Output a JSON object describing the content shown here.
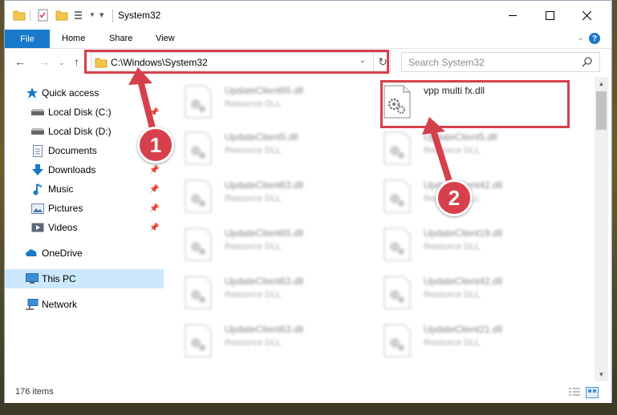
{
  "window": {
    "title": "System32",
    "controls": {
      "minimize": "—",
      "maximize": "☐",
      "close": "✕"
    }
  },
  "ribbon": {
    "file_tab": "File",
    "tabs": [
      "Home",
      "Share",
      "View"
    ],
    "help": "?"
  },
  "address_bar": {
    "path": "C:\\Windows\\System32",
    "search_placeholder": "Search System32"
  },
  "nav_pane": {
    "items": [
      {
        "label": "Quick access",
        "icon": "star-icon",
        "pinned": false
      },
      {
        "label": "Local Disk (C:)",
        "icon": "drive-icon",
        "pinned": true
      },
      {
        "label": "Local Disk (D:)",
        "icon": "drive-icon",
        "pinned": false
      },
      {
        "label": "Documents",
        "icon": "documents-icon",
        "pinned": true
      },
      {
        "label": "Downloads",
        "icon": "downloads-icon",
        "pinned": true
      },
      {
        "label": "Music",
        "icon": "music-icon",
        "pinned": true
      },
      {
        "label": "Pictures",
        "icon": "pictures-icon",
        "pinned": true
      },
      {
        "label": "Videos",
        "icon": "videos-icon",
        "pinned": true
      },
      {
        "label": "OneDrive",
        "icon": "onedrive-icon",
        "pinned": false
      },
      {
        "label": "This PC",
        "icon": "pc-icon",
        "pinned": false,
        "selected": true
      },
      {
        "label": "Network",
        "icon": "network-icon",
        "pinned": false
      }
    ]
  },
  "files": {
    "left_column": [
      {
        "name": "UpdateClient65.dll",
        "type": "Resource DLL"
      },
      {
        "name": "UpdateClient5.dll",
        "type": "Resource DLL"
      },
      {
        "name": "UpdateClient63.dll",
        "type": "Resource DLL"
      },
      {
        "name": "UpdateClient65.dll",
        "type": "Resource DLL"
      },
      {
        "name": "UpdateClient63.dll",
        "type": "Resource DLL"
      },
      {
        "name": "UpdateClient63.dll",
        "type": "Resource DLL"
      }
    ],
    "right_column": [
      {
        "name": "vpp multi fx.dll",
        "type": "",
        "highlighted": true
      },
      {
        "name": "UpdateClient5.dll",
        "type": "Resource DLL"
      },
      {
        "name": "UpdateClient42.dll",
        "type": "Resource DLL"
      },
      {
        "name": "UpdateClient19.dll",
        "type": "Resource DLL"
      },
      {
        "name": "UpdateClient42.dll",
        "type": "Resource DLL"
      },
      {
        "name": "UpdateClient21.dll",
        "type": "Resource DLL"
      }
    ]
  },
  "status_bar": {
    "item_count": "176 items"
  },
  "callouts": [
    {
      "number": "1",
      "color": "#d6404a"
    },
    {
      "number": "2",
      "color": "#d6404a"
    }
  ],
  "colors": {
    "accent": "#1979ca",
    "callout": "#d6404a",
    "selection": "#cce8ff"
  }
}
